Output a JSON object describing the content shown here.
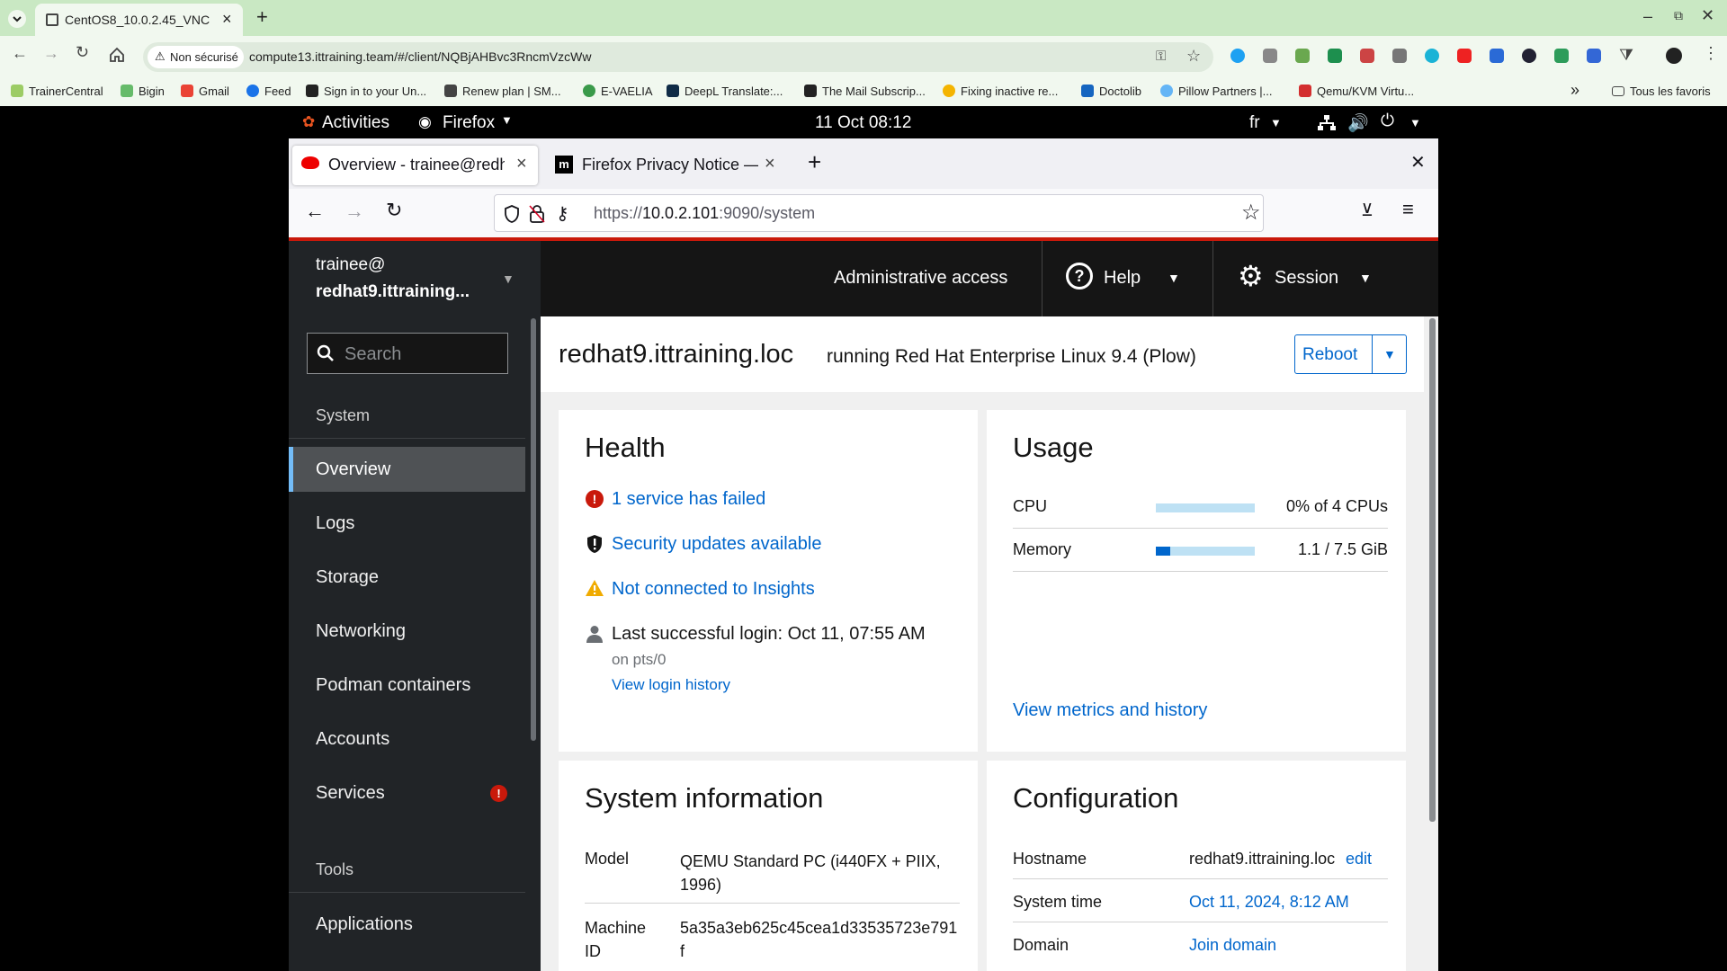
{
  "host_browser": {
    "tab_title": "CentOS8_10.0.2.45_VNC",
    "security_label": "Non sécurisé",
    "url": "compute13.ittraining.team/#/client/NQBjAHBvc3RncmVzcWw",
    "bookmarks": [
      "TrainerCentral",
      "Bigin",
      "Gmail",
      "Feed",
      "Sign in to your Un...",
      "Renew plan | SM...",
      "E-VAELIA",
      "DeepL Translate:...",
      "The Mail Subscrip...",
      "Fixing inactive re...",
      "Doctolib",
      "Pillow Partners |...",
      "Qemu/KVM Virtu..."
    ],
    "more_bookmarks": "»",
    "all_bookmarks": "Tous les favoris"
  },
  "gnome": {
    "activities": "Activities",
    "app": "Firefox",
    "clock": "11 Oct  08:12",
    "lang": "fr"
  },
  "firefox": {
    "tabs": [
      {
        "label": "Overview - trainee@redha"
      },
      {
        "label": "Firefox Privacy Notice — N"
      }
    ],
    "url_prefix": "https://",
    "url_host": "10.0.2.101",
    "url_rest": ":9090/system"
  },
  "cockpit": {
    "user": "trainee@",
    "host_short": "redhat9.ittraining...",
    "admin_access": "Administrative access",
    "help": "Help",
    "session": "Session",
    "search_placeholder": "Search",
    "section_system": "System",
    "nav": [
      {
        "label": "Overview",
        "active": true
      },
      {
        "label": "Logs"
      },
      {
        "label": "Storage"
      },
      {
        "label": "Networking"
      },
      {
        "label": "Podman containers"
      },
      {
        "label": "Accounts"
      },
      {
        "label": "Services",
        "badge": "!"
      }
    ],
    "section_tools": "Tools",
    "tools_nav": [
      {
        "label": "Applications"
      }
    ],
    "hostname_title": "redhat9.ittraining.loc",
    "os_running": "running Red Hat Enterprise Linux 9.4 (Plow)",
    "reboot": "Reboot",
    "health": {
      "title": "Health",
      "failed": "1 service has failed",
      "security": "Security updates available",
      "insights": "Not connected to Insights",
      "last_login": "Last successful login: Oct 11, 07:55 AM",
      "on_pts": "on pts/0",
      "login_history": "View login history"
    },
    "usage": {
      "title": "Usage",
      "cpu_label": "CPU",
      "cpu_value": "0% of 4 CPUs",
      "cpu_fraction": 0.0,
      "mem_label": "Memory",
      "mem_value": "1.1 / 7.5 GiB",
      "mem_fraction": 0.147,
      "metrics_link": "View metrics and history"
    },
    "sysinfo": {
      "title": "System information",
      "model_label": "Model",
      "model_value": "QEMU Standard PC (i440FX + PIIX, 1996)",
      "machine_label": "Machine ID",
      "machine_value": "5a35a3eb625c45cea1d33535723e791f"
    },
    "config": {
      "title": "Configuration",
      "hostname_label": "Hostname",
      "hostname_value": "redhat9.ittraining.loc",
      "edit": "edit",
      "time_label": "System time",
      "time_value": "Oct 11, 2024, 8:12 AM",
      "domain_label": "Domain",
      "domain_value": "Join domain"
    }
  }
}
